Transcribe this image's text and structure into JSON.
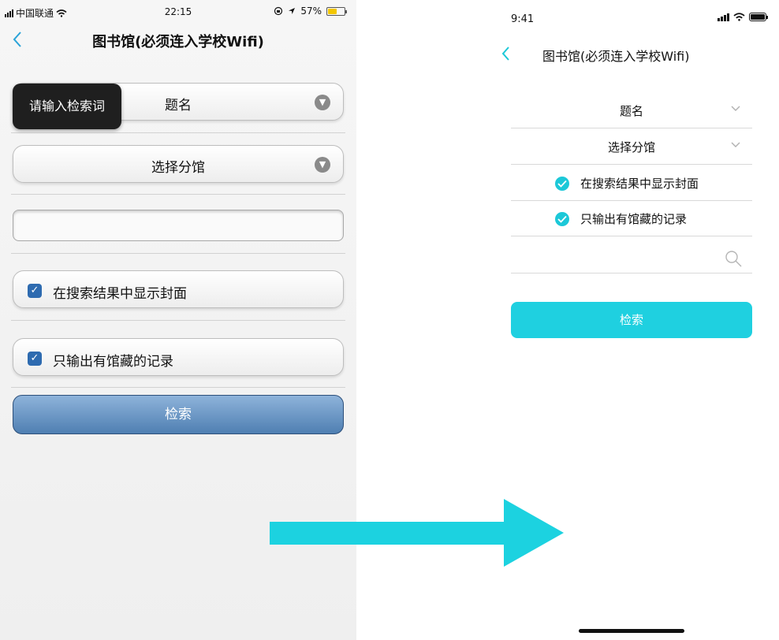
{
  "old_screen": {
    "status": {
      "carrier": "中国联通",
      "time": "22:15",
      "battery": "57%",
      "battery_level": 0.57
    },
    "title": "图书馆(必须连入学校Wifi)",
    "field_select": "题名",
    "tooltip": "请输入检索词",
    "branch_select": "选择分馆",
    "search_input_value": "",
    "checkbox_cover": {
      "label": "在搜索结果中显示封面",
      "checked": true
    },
    "checkbox_holdings": {
      "label": "只输出有馆藏的记录",
      "checked": true
    },
    "search_button": "检索"
  },
  "new_screen": {
    "status": {
      "time": "9:41"
    },
    "title": "图书馆(必须连入学校Wifi)",
    "field_select": "题名",
    "branch_select": "选择分馆",
    "checkbox_cover": {
      "label": "在搜索结果中显示封面",
      "checked": true
    },
    "checkbox_holdings": {
      "label": "只输出有馆藏的记录",
      "checked": true
    },
    "search_input_value": "",
    "search_button": "检索",
    "accent_color": "#1fd0e0"
  },
  "icons": {
    "back": "chevron-left-icon",
    "dropdown": "chevron-down-icon",
    "search": "search-icon",
    "check": "check-icon",
    "arrow": "arrow-right-icon"
  }
}
